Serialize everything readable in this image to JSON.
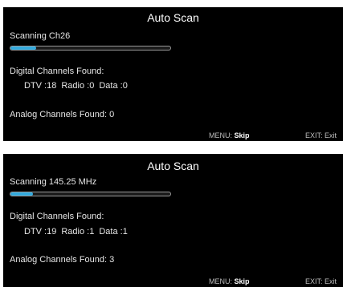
{
  "screens": [
    {
      "title": "Auto Scan",
      "scan_label": "Scanning Ch26",
      "progress": 0.16,
      "digital_label": "Digital Channels Found:",
      "dtv": "DTV :18",
      "radio": "Radio :0",
      "data": "Data :0",
      "analog_label": "Analog Channels Found: 0",
      "menu_key": "MENU:",
      "menu_action": "Skip",
      "exit_key": "EXIT:",
      "exit_action": "Exit"
    },
    {
      "title": "Auto Scan",
      "scan_label": "Scanning 145.25 MHz",
      "progress": 0.14,
      "digital_label": "Digital Channels Found:",
      "dtv": "DTV :19",
      "radio": "Radio :1",
      "data": "Data :1",
      "analog_label": "Analog Channels Found: 3",
      "menu_key": "MENU:",
      "menu_action": "Skip",
      "exit_key": "EXIT:",
      "exit_action": "Exit"
    }
  ],
  "colors": {
    "background": "#000000",
    "progress_fill": "#33aadd"
  }
}
